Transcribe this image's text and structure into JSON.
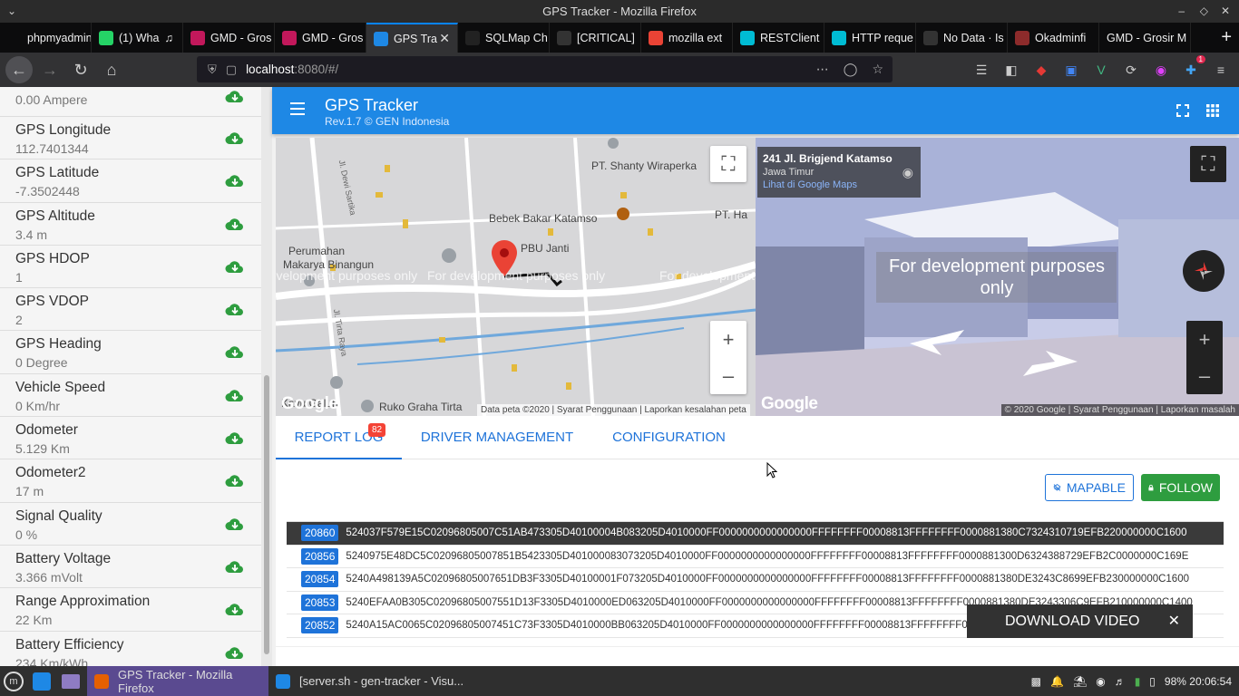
{
  "window": {
    "title": "GPS Tracker - Mozilla Firefox"
  },
  "browser_tabs": [
    {
      "label": "phpmyadmin.te",
      "icon": "phpmyadmin-icon",
      "color": "#0c0c0d"
    },
    {
      "label": "(1) Wha",
      "icon": "whatsapp-icon",
      "color": "#25d366"
    },
    {
      "label": "GMD - Gros",
      "icon": "gmd-icon",
      "color": "#c2185b"
    },
    {
      "label": "GMD - Gros",
      "icon": "gmd-icon",
      "color": "#c2185b"
    },
    {
      "label": "GPS Tra",
      "icon": "gps-tracker-icon",
      "color": "#1e88e5"
    },
    {
      "label": "SQLMap Ch",
      "icon": "medium-icon",
      "color": "#222"
    },
    {
      "label": "[CRITICAL]",
      "icon": "github-icon",
      "color": "#333"
    },
    {
      "label": "mozilla ext",
      "icon": "google-icon",
      "color": "#ea4335"
    },
    {
      "label": "RESTClient",
      "icon": "restclient-icon",
      "color": "#00bcd4"
    },
    {
      "label": "HTTP reque",
      "icon": "restclient-icon",
      "color": "#00bcd4"
    },
    {
      "label": "No Data · Is",
      "icon": "github-icon",
      "color": "#333"
    },
    {
      "label": "Okadminfi",
      "icon": "okadmin-icon",
      "color": "#8d2b2b"
    },
    {
      "label": "GMD - Grosir M",
      "icon": "",
      "color": ""
    }
  ],
  "url": {
    "host": "localhost",
    "path": ":8080/#/"
  },
  "sidebar": [
    {
      "label": "",
      "value": "0.00 Ampere"
    },
    {
      "label": "GPS Longitude",
      "value": "112.7401344"
    },
    {
      "label": "GPS Latitude",
      "value": "-7.3502448"
    },
    {
      "label": "GPS Altitude",
      "value": "3.4 m"
    },
    {
      "label": "GPS HDOP",
      "value": "1"
    },
    {
      "label": "GPS VDOP",
      "value": "2"
    },
    {
      "label": "GPS Heading",
      "value": "0 Degree"
    },
    {
      "label": "Vehicle Speed",
      "value": "0 Km/hr"
    },
    {
      "label": "Odometer",
      "value": "5.129 Km"
    },
    {
      "label": "Odometer2",
      "value": "17 m"
    },
    {
      "label": "Signal Quality",
      "value": "0 %"
    },
    {
      "label": "Battery Voltage",
      "value": "3.366 mVolt"
    },
    {
      "label": "Range Approximation",
      "value": "22 Km"
    },
    {
      "label": "Battery Efficiency",
      "value": "234 Km/kWh"
    }
  ],
  "header": {
    "title": "GPS Tracker",
    "subtitle": "Rev.1.7 © GEN Indonesia"
  },
  "map": {
    "labels": [
      "PT. Shanty Wiraperka",
      "Jl. Dewi Sartika",
      "Bebek Bakar Katamso",
      "PT. Ha",
      "PBU Janti",
      "Perumahan",
      "Makarya Binangun",
      "Jl. Tirta Raya",
      "Kavu Galuh",
      "Ruko Graha Tirta"
    ],
    "dev_text": "For development purposes only",
    "footer": [
      "Data peta ©2020",
      "Syarat Penggunaan",
      "Laporkan kesalahan peta"
    ],
    "logo": "Google"
  },
  "streetview": {
    "address": "241 Jl. Brigjend Katamso",
    "region": "Jawa Timur",
    "link": "Lihat di Google Maps",
    "dev_text": "For development purposes only",
    "footer": [
      "© 2020 Google",
      "Syarat Penggunaan",
      "Laporkan masalah"
    ],
    "logo": "Google"
  },
  "panel": {
    "tabs": [
      "REPORT LOG",
      "DRIVER MANAGEMENT",
      "CONFIGURATION"
    ],
    "badge": "82",
    "mapable": "MAPABLE",
    "follow": "FOLLOW",
    "logs": [
      {
        "id": "20860",
        "hex": "524037F579E15C02096805007C51AB473305D40100004B083205D4010000FF0000000000000000FFFFFFFF00008813FFFFFFFF0000881380C7324310719EFB220000000C1600"
      },
      {
        "id": "20856",
        "hex": "5240975E48DC5C02096805007851B5423305D401000083073205D4010000FF0000000000000000FFFFFFFF00008813FFFFFFFF0000881300D6324388729EFB2C0000000C169E"
      },
      {
        "id": "20854",
        "hex": "5240A498139A5C02096805007651DB3F3305D40100001F073205D4010000FF0000000000000000FFFFFFFF00008813FFFFFFFF0000881380DE3243C8699EFB230000000C1600"
      },
      {
        "id": "20853",
        "hex": "5240EFAA0B305C02096805007551D13F3305D4010000ED063205D4010000FF0000000000000000FFFFFFFF00008813FFFFFFFF0000881380DE3243306C9EFB210000000C1400"
      },
      {
        "id": "20852",
        "hex": "5240A15AC0065C02096805007451C73F3305D4010000BB063205D4010000FF0000000000000000FFFFFFFF00008813FFFFFFFF0000881380DE3243C86B9EFB200000000C1600"
      }
    ]
  },
  "toast": {
    "text": "DOWNLOAD VIDEO"
  },
  "taskbar": {
    "tasks": [
      "GPS Tracker - Mozilla Firefox",
      "[server.sh - gen-tracker - Visu..."
    ],
    "battery": "98%",
    "time": "20:06:54"
  }
}
